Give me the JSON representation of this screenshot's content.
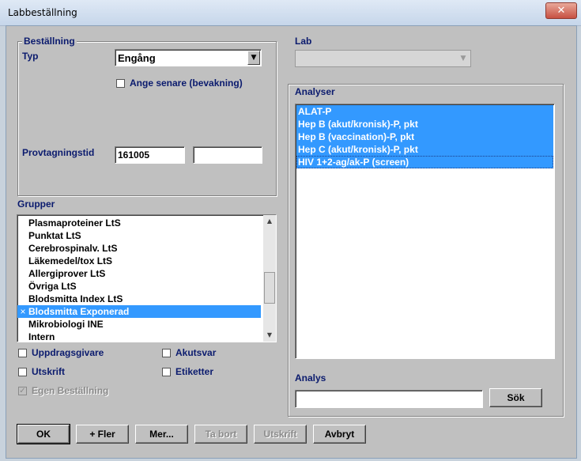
{
  "window": {
    "title": "Labbeställning",
    "close_glyph": "✕"
  },
  "bestallning": {
    "legend": "Beställning",
    "typ_label": "Typ",
    "typ_value": "Engång",
    "ange_senare_label": "Ange senare (bevakning)",
    "provtagningstid_label": "Provtagningstid",
    "provtagningstid_date": "161005",
    "provtagningstid_time": ""
  },
  "lab": {
    "label": "Lab",
    "value": ""
  },
  "grupper": {
    "label": "Grupper",
    "items": [
      {
        "text": "Plasmaproteiner LtS",
        "selected": false
      },
      {
        "text": "Punktat LtS",
        "selected": false
      },
      {
        "text": "Cerebrospinalv. LtS",
        "selected": false
      },
      {
        "text": "Läkemedel/tox LtS",
        "selected": false
      },
      {
        "text": "Allergiprover LtS",
        "selected": false
      },
      {
        "text": "Övriga LtS",
        "selected": false
      },
      {
        "text": "Blodsmitta Index LtS",
        "selected": false
      },
      {
        "text": "Blodsmitta Exponerad",
        "selected": true,
        "mark": "×"
      },
      {
        "text": "Mikrobiologi INE",
        "selected": false
      },
      {
        "text": "Intern",
        "selected": false
      }
    ]
  },
  "options": {
    "uppdragsgivare": "Uppdragsgivare",
    "akutsvar": "Akutsvar",
    "utskrift": "Utskrift",
    "etiketter": "Etiketter",
    "egen_bestallning": "Egen Beställning",
    "egen_check_glyph": "✓"
  },
  "analyser": {
    "legend": "Analyser",
    "items": [
      "ALAT-P",
      "Hep B (akut/kronisk)-P, pkt",
      "Hep B (vaccination)-P, pkt",
      "Hep C (akut/kronisk)-P, pkt",
      "HIV 1+2-ag/ak-P (screen)"
    ]
  },
  "analys": {
    "label": "Analys",
    "value": "",
    "search_button": "Sök"
  },
  "buttons": {
    "ok": "OK",
    "fler": "+ Fler",
    "mer": "Mer...",
    "ta_bort": "Ta bort",
    "utskrift": "Utskrift",
    "avbryt": "Avbryt"
  }
}
